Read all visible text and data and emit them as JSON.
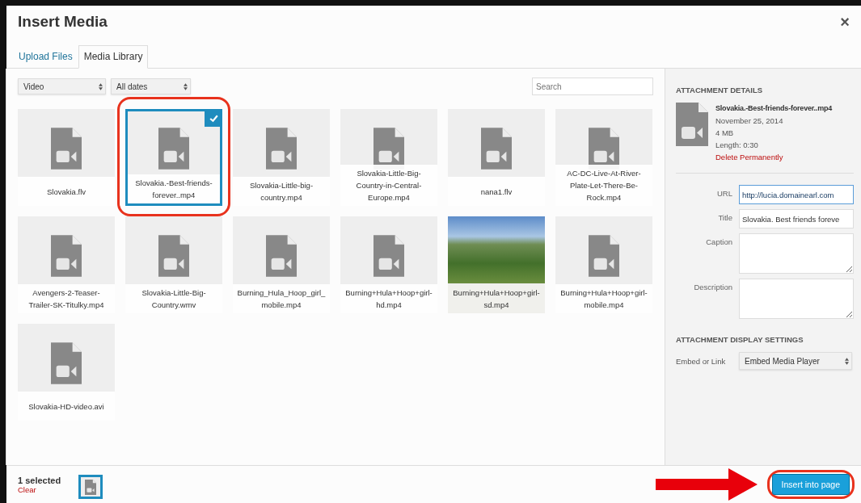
{
  "window": {
    "title": "Insert Media",
    "close": "×"
  },
  "tabs": [
    {
      "label": "Upload Files",
      "selected": false
    },
    {
      "label": "Media Library",
      "selected": true
    }
  ],
  "filters": [
    {
      "value": "Video"
    },
    {
      "value": "All dates"
    }
  ],
  "search": {
    "placeholder": "Search"
  },
  "items": [
    {
      "name": "Slovakia.flv",
      "kind": "video",
      "selected": false
    },
    {
      "name": "Slovakia.-Best-friends-forever..mp4",
      "kind": "video",
      "selected": true
    },
    {
      "name": "Slovakia-Little-big-country.mp4",
      "kind": "video",
      "selected": false
    },
    {
      "name": "Slovakia-Little-Big-Country-in-Central-Europe.mp4",
      "kind": "video",
      "selected": false
    },
    {
      "name": "nana1.flv",
      "kind": "video",
      "selected": false
    },
    {
      "name": "AC-DC-Live-At-River-Plate-Let-There-Be-Rock.mp4",
      "kind": "video",
      "selected": false
    },
    {
      "name": "Avengers-2-Teaser-Trailer-SK-Titulky.mp4",
      "kind": "video",
      "selected": false
    },
    {
      "name": "Slovakia-Little-Big-Country.wmv",
      "kind": "video",
      "selected": false
    },
    {
      "name": "Burning_Hula_Hoop_girl_mobile.mp4",
      "kind": "video",
      "selected": false
    },
    {
      "name": "Burning+Hula+Hoop+girl-hd.mp4",
      "kind": "video",
      "selected": false
    },
    {
      "name": "Burning+Hula+Hoop+girl-sd.mp4",
      "kind": "image",
      "selected": false
    },
    {
      "name": "Burning+Hula+Hoop+girl-mobile.mp4",
      "kind": "video",
      "selected": false
    },
    {
      "name": "Slovakia-HD-video.avi",
      "kind": "video",
      "selected": false
    }
  ],
  "details": {
    "heading": "ATTACHMENT DETAILS",
    "filename": "Slovakia.-Best-friends-forever..mp4",
    "date": "November 25, 2014",
    "size": "4 MB",
    "length": "Length: 0:30",
    "delete": "Delete Permanently",
    "fields": [
      {
        "label": "URL",
        "kind": "input",
        "value": "http://lucia.domainearl.com",
        "highlighted": true
      },
      {
        "label": "Title",
        "kind": "input",
        "value": "Slovakia. Best friends foreve",
        "highlighted": false
      },
      {
        "label": "Caption",
        "kind": "textarea"
      },
      {
        "label": "Description",
        "kind": "textarea"
      }
    ]
  },
  "display_settings": {
    "heading": "ATTACHMENT DISPLAY SETTINGS",
    "label": "Embed or Link",
    "value": "Embed Media Player"
  },
  "footer": {
    "count": "1 selected",
    "clear": "Clear",
    "button": "Insert into page"
  }
}
